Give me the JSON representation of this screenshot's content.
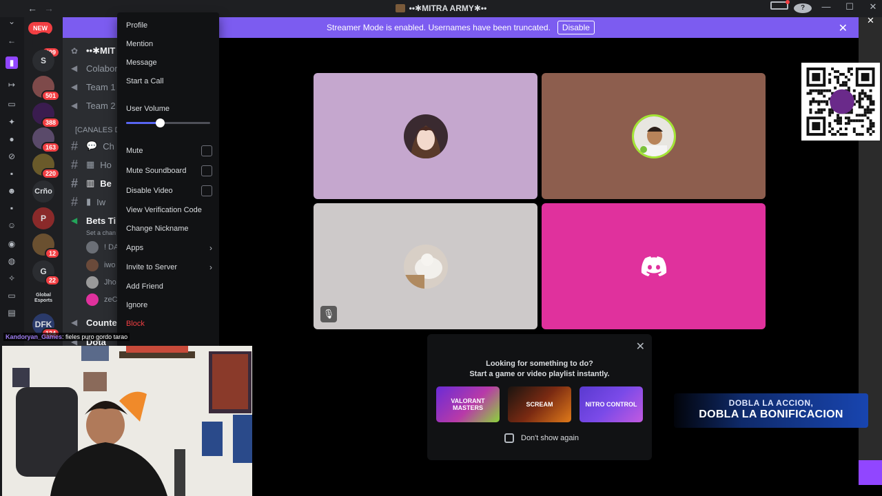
{
  "window": {
    "title": "••✱MITRA ARMY✱••"
  },
  "banner": {
    "message": "Streamer Mode is enabled. Usernames have been truncated.",
    "button": "Disable"
  },
  "rail": {
    "new_pill": "NEW",
    "servers": [
      {
        "label": "",
        "badge": "409"
      },
      {
        "label": "S",
        "badge": ""
      },
      {
        "label": "",
        "badge": "501"
      },
      {
        "label": "",
        "badge": "388"
      },
      {
        "label": "",
        "badge": "163"
      },
      {
        "label": "",
        "badge": "220"
      },
      {
        "label": "Crño",
        "badge": ""
      },
      {
        "label": "",
        "badge": ""
      },
      {
        "label": "",
        "badge": "12"
      },
      {
        "label": "G",
        "badge": "22"
      },
      {
        "label": "Global Esports",
        "badge": ""
      },
      {
        "label": "DFK",
        "badge": "124"
      }
    ]
  },
  "sidebar": {
    "server_name": "••✱MIT",
    "channels": [
      "Colabor",
      "Team 1",
      "Team 2"
    ],
    "category": "[CANALES D",
    "text_channels": [
      "Ch",
      "Ho",
      "Be",
      "Iw"
    ],
    "active_voice": "Bets Ti",
    "active_voice_status": "Set a chan",
    "voice_users": [
      "! DA",
      "iwo",
      "Jho",
      "zeC"
    ],
    "more": [
      "Counte",
      "Dota"
    ]
  },
  "context_menu": {
    "items": [
      "Profile",
      "Mention",
      "Message",
      "Start a Call"
    ],
    "volume_label": "User Volume",
    "volume_fraction": 0.4,
    "toggles": [
      "Mute",
      "Mute Soundboard",
      "Disable Video"
    ],
    "more_items": [
      "View Verification Code",
      "Change Nickname"
    ],
    "submenus": [
      "Apps",
      "Invite to Server"
    ],
    "tail_items": [
      "Add Friend",
      "Ignore"
    ],
    "danger_item": "Block"
  },
  "stage": {
    "tile_colors": [
      "#c5a7ce",
      "#8d5e4e",
      "#cdc9c9",
      "#e0319d"
    ]
  },
  "activity": {
    "line1": "Looking for something to do?",
    "line2": "Start a game or video playlist instantly.",
    "games": [
      "VALORANT MASTERS",
      "SCREAM",
      "NITRO CONTROL"
    ],
    "dont_show": "Don't show again"
  },
  "chat": {
    "user": "Kandoryan_Games",
    "message": ": fieles puro gordo tarao"
  },
  "promo": {
    "line1": "DOBLA LA ACCION,",
    "line2": "DOBLA LA BONIFICACION"
  },
  "colors": {
    "blurple": "#5865f2",
    "banner": "#7c5cf0",
    "danger": "#f23f43"
  }
}
